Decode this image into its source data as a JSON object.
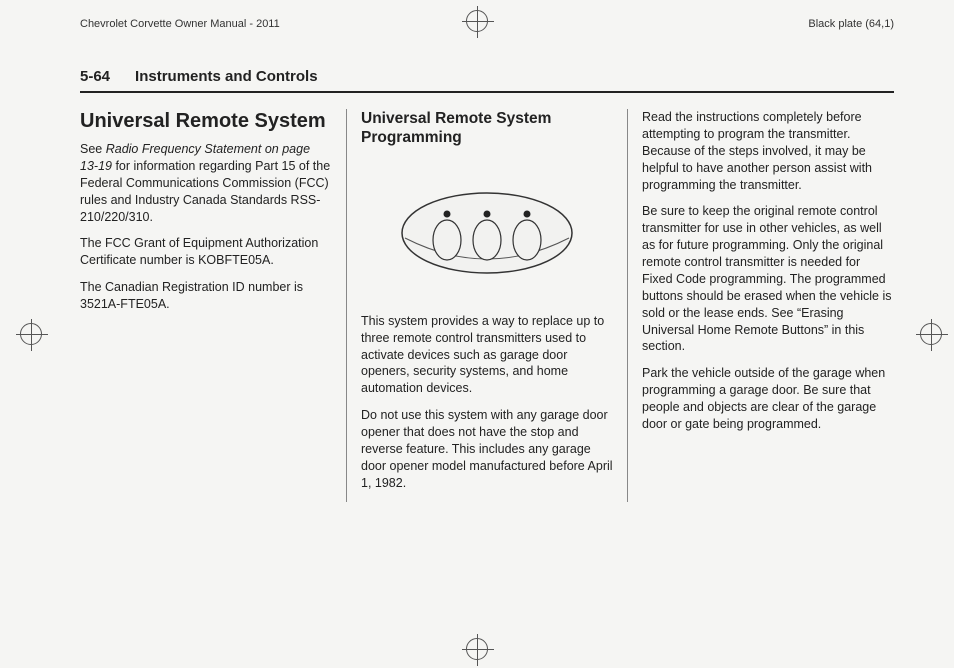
{
  "top": {
    "left": "Chevrolet Corvette Owner Manual - 2011",
    "right": "Black plate (64,1)"
  },
  "header": {
    "page_num": "5-64",
    "section": "Instruments and Controls"
  },
  "col1": {
    "h1": "Universal Remote System",
    "p1a": "See ",
    "p1b": "Radio Frequency Statement on page 13‑19",
    "p1c": " for information regarding Part 15 of the Federal Communications Commission (FCC) rules and Industry Canada Standards RSS-210/220/310.",
    "p2": "The FCC Grant of Equipment Authorization Certificate number is KOBFTE05A.",
    "p3": "The Canadian Registration ID number is 3521A-FTE05A."
  },
  "col2": {
    "h2": "Universal Remote System Programming",
    "p1": "This system provides a way to replace up to three remote control transmitters used to activate devices such as garage door openers, security systems, and home automation devices.",
    "p2": "Do not use this system with any garage door opener that does not have the stop and reverse feature. This includes any garage door opener model manufactured before April 1, 1982."
  },
  "col3": {
    "p1": "Read the instructions completely before attempting to program the transmitter. Because of the steps involved, it may be helpful to have another person assist with programming the transmitter.",
    "p2": "Be sure to keep the original remote control transmitter for use in other vehicles, as well as for future programming. Only the original remote control transmitter is needed for Fixed Code programming. The programmed buttons should be erased when the vehicle is sold or the lease ends. See “Erasing Universal Home Remote Buttons” in this section.",
    "p3": "Park the vehicle outside of the garage when programming a garage door. Be sure that people and objects are clear of the garage door or gate being programmed."
  }
}
